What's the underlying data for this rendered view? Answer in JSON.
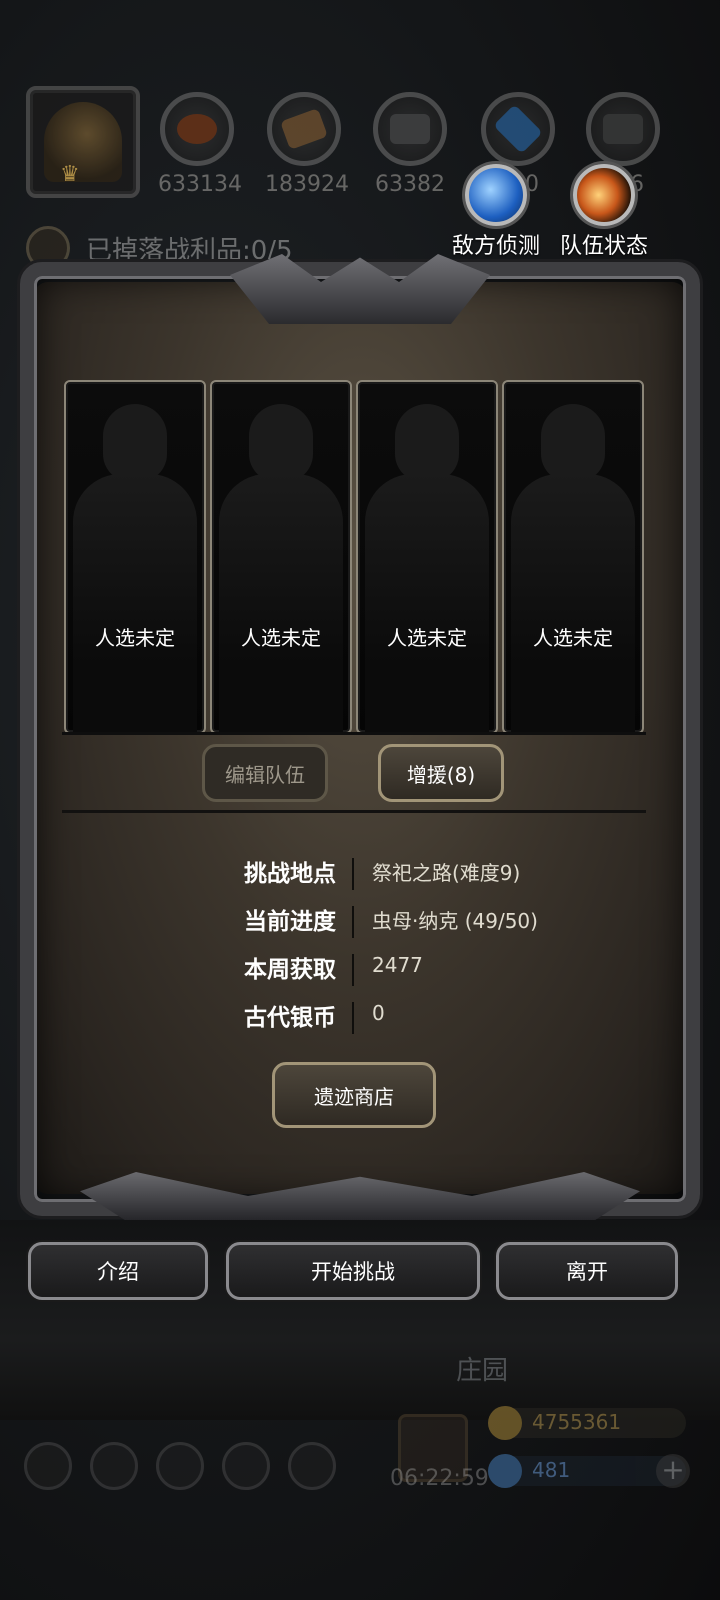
{
  "resources": [
    {
      "icon": "meat-icon",
      "value": "633134",
      "color": "#8a3d16"
    },
    {
      "icon": "wood-icon",
      "value": "183924",
      "color": "#8b6236"
    },
    {
      "icon": "stone-icon",
      "value": "63382",
      "color": "#555555"
    },
    {
      "icon": "crystal-icon",
      "value": "500",
      "color": "#2d6fb2"
    },
    {
      "icon": "iron-icon",
      "value": "696",
      "color": "#4a4a4a"
    }
  ],
  "tools": {
    "enemy_scout": "敌方侦测",
    "team_status": "队伍状态"
  },
  "loot_text": "已掉落战利品:0/5",
  "slots": [
    "人选未定",
    "人选未定",
    "人选未定",
    "人选未定"
  ],
  "buttons": {
    "edit_team": "编辑队伍",
    "reinforce": "增援(8)",
    "ruins_shop": "遗迹商店",
    "intro": "介绍",
    "start": "开始挑战",
    "leave": "离开"
  },
  "info": [
    {
      "key": "挑战地点",
      "value": "祭祀之路(难度9)"
    },
    {
      "key": "当前进度",
      "value": "虫母·纳克 (49/50)"
    },
    {
      "key": "本周获取",
      "value": "2477"
    },
    {
      "key": "古代银币",
      "value": "0"
    }
  ],
  "hud": {
    "manor": "庄园",
    "timer": "06:22:59",
    "gold": "4755361",
    "gems": "481"
  },
  "colors": {
    "accent_gold": "#c8a040",
    "accent_blue": "#4e8fd6",
    "panel_parchment": "#3c352c"
  }
}
